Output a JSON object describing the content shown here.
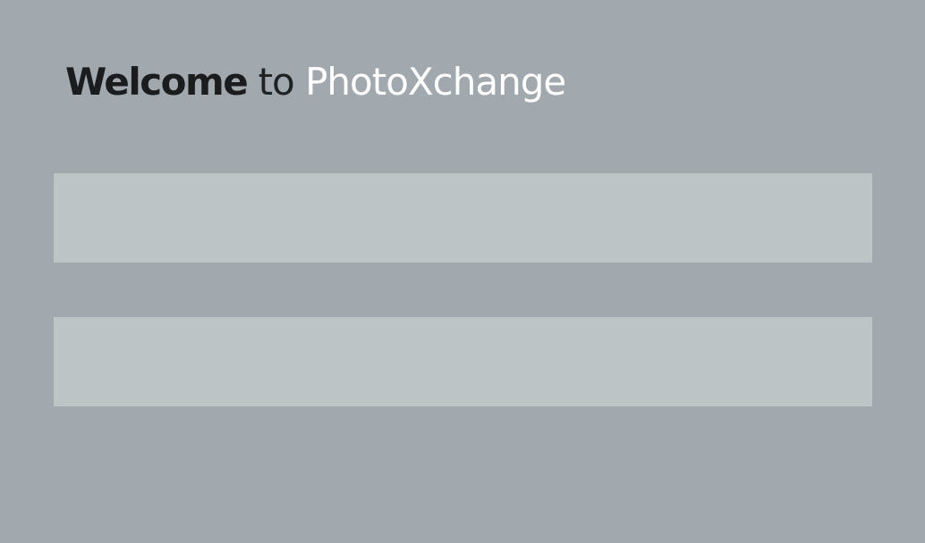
{
  "header": {
    "welcome_bold": "Welcome",
    "welcome_connector": " to ",
    "brand_name": "PhotoXchange"
  },
  "form": {
    "fields": [
      {
        "value": "",
        "placeholder": ""
      },
      {
        "value": "",
        "placeholder": ""
      }
    ]
  },
  "colors": {
    "background": "#a1a8ae",
    "field_background": "#bcc4c6",
    "heading_dark": "#1a1c1d",
    "brand": "#ffffff"
  }
}
